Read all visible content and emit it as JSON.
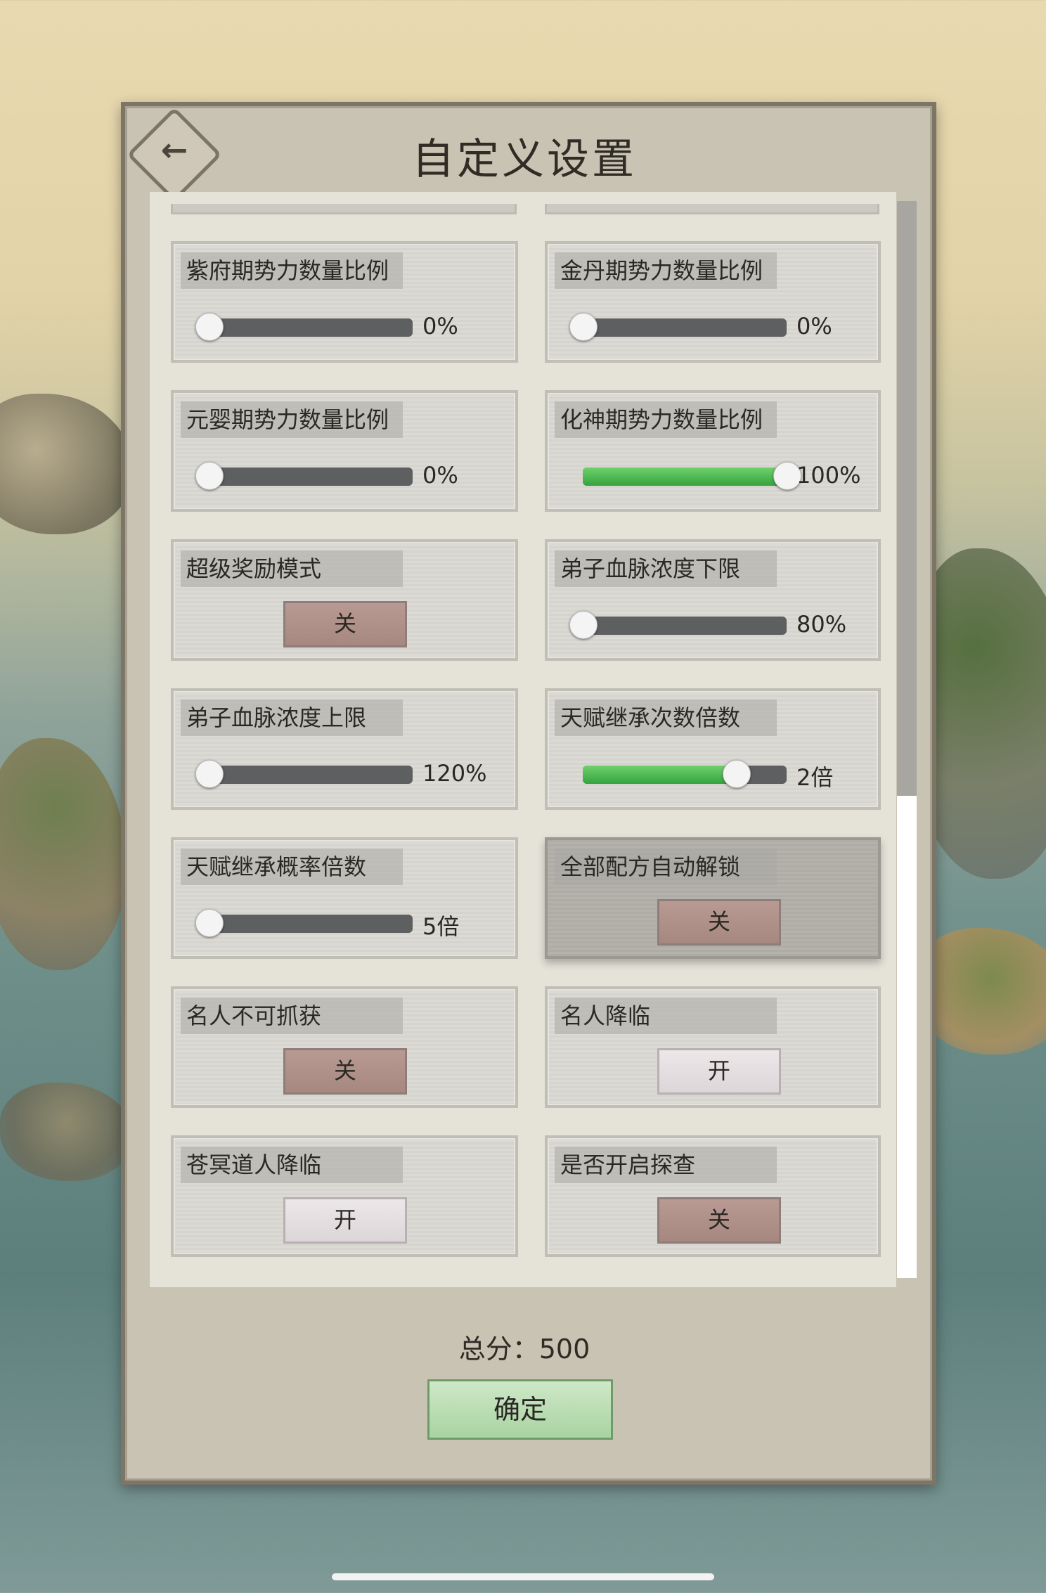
{
  "window": {
    "title": "自定义设置"
  },
  "footer": {
    "total_label": "总分：500",
    "confirm_label": "确定"
  },
  "settings": [
    {
      "label": "紫府期势力数量比例",
      "type": "slider",
      "value_text": "0%",
      "fraction": 0.0
    },
    {
      "label": "金丹期势力数量比例",
      "type": "slider",
      "value_text": "0%",
      "fraction": 0.0
    },
    {
      "label": "元婴期势力数量比例",
      "type": "slider",
      "value_text": "0%",
      "fraction": 0.0
    },
    {
      "label": "化神期势力数量比例",
      "type": "slider",
      "value_text": "100%",
      "fraction": 1.0
    },
    {
      "label": "超级奖励模式",
      "type": "toggle",
      "value_text": "关",
      "state": "off"
    },
    {
      "label": "弟子血脉浓度下限",
      "type": "slider",
      "value_text": "80%",
      "fraction": 0.0
    },
    {
      "label": "弟子血脉浓度上限",
      "type": "slider",
      "value_text": "120%",
      "fraction": 0.0
    },
    {
      "label": "天赋继承次数倍数",
      "type": "slider",
      "value_text": "2倍",
      "fraction": 0.75
    },
    {
      "label": "天赋继承概率倍数",
      "type": "slider",
      "value_text": "5倍",
      "fraction": 0.0
    },
    {
      "label": "全部配方自动解锁",
      "type": "toggle",
      "value_text": "关",
      "state": "off",
      "highlighted": true
    },
    {
      "label": "名人不可抓获",
      "type": "toggle",
      "value_text": "关",
      "state": "off"
    },
    {
      "label": "名人降临",
      "type": "toggle",
      "value_text": "开",
      "state": "on"
    },
    {
      "label": "苍冥道人降临",
      "type": "toggle",
      "value_text": "开",
      "state": "on"
    },
    {
      "label": "是否开启探查",
      "type": "toggle",
      "value_text": "关",
      "state": "off"
    }
  ],
  "scrollbar": {
    "position_fraction": 0.0
  }
}
